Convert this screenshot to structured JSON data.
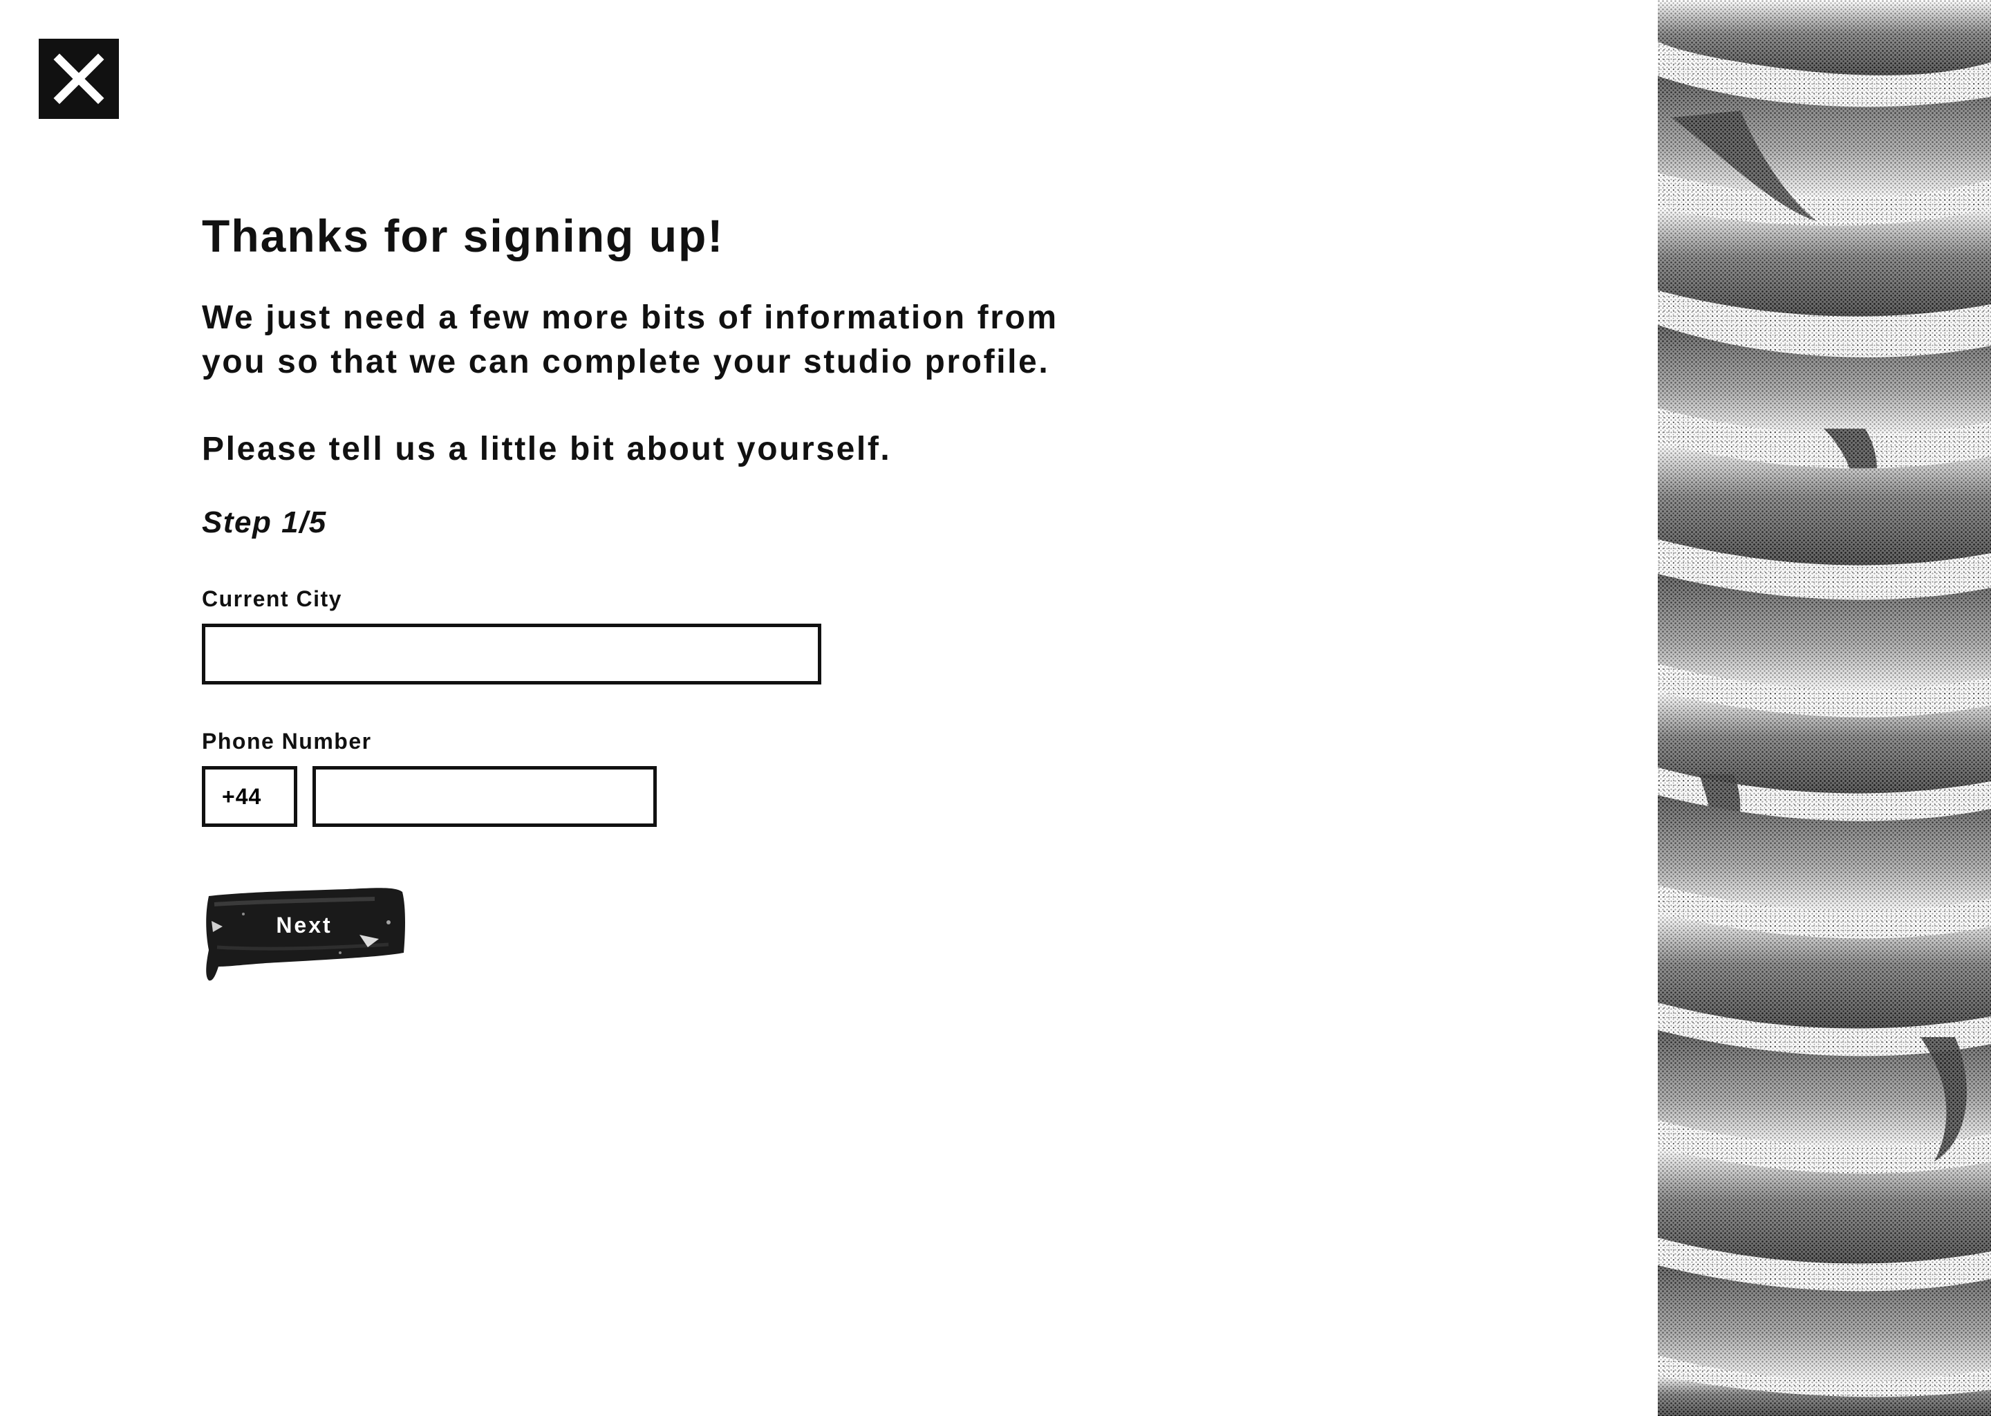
{
  "close_icon": "close-icon",
  "title": "Thanks for signing up!",
  "intro": "We just need a few more bits of information from you so that we can complete your studio profile.",
  "prompt": "Please tell us a little bit about yourself.",
  "step": "Step 1/5",
  "form": {
    "city": {
      "label": "Current City",
      "value": ""
    },
    "phone": {
      "label": "Phone Number",
      "country_code": "+44",
      "value": ""
    },
    "next_label": "Next"
  },
  "colors": {
    "ink": "#111111",
    "background": "#ffffff"
  }
}
